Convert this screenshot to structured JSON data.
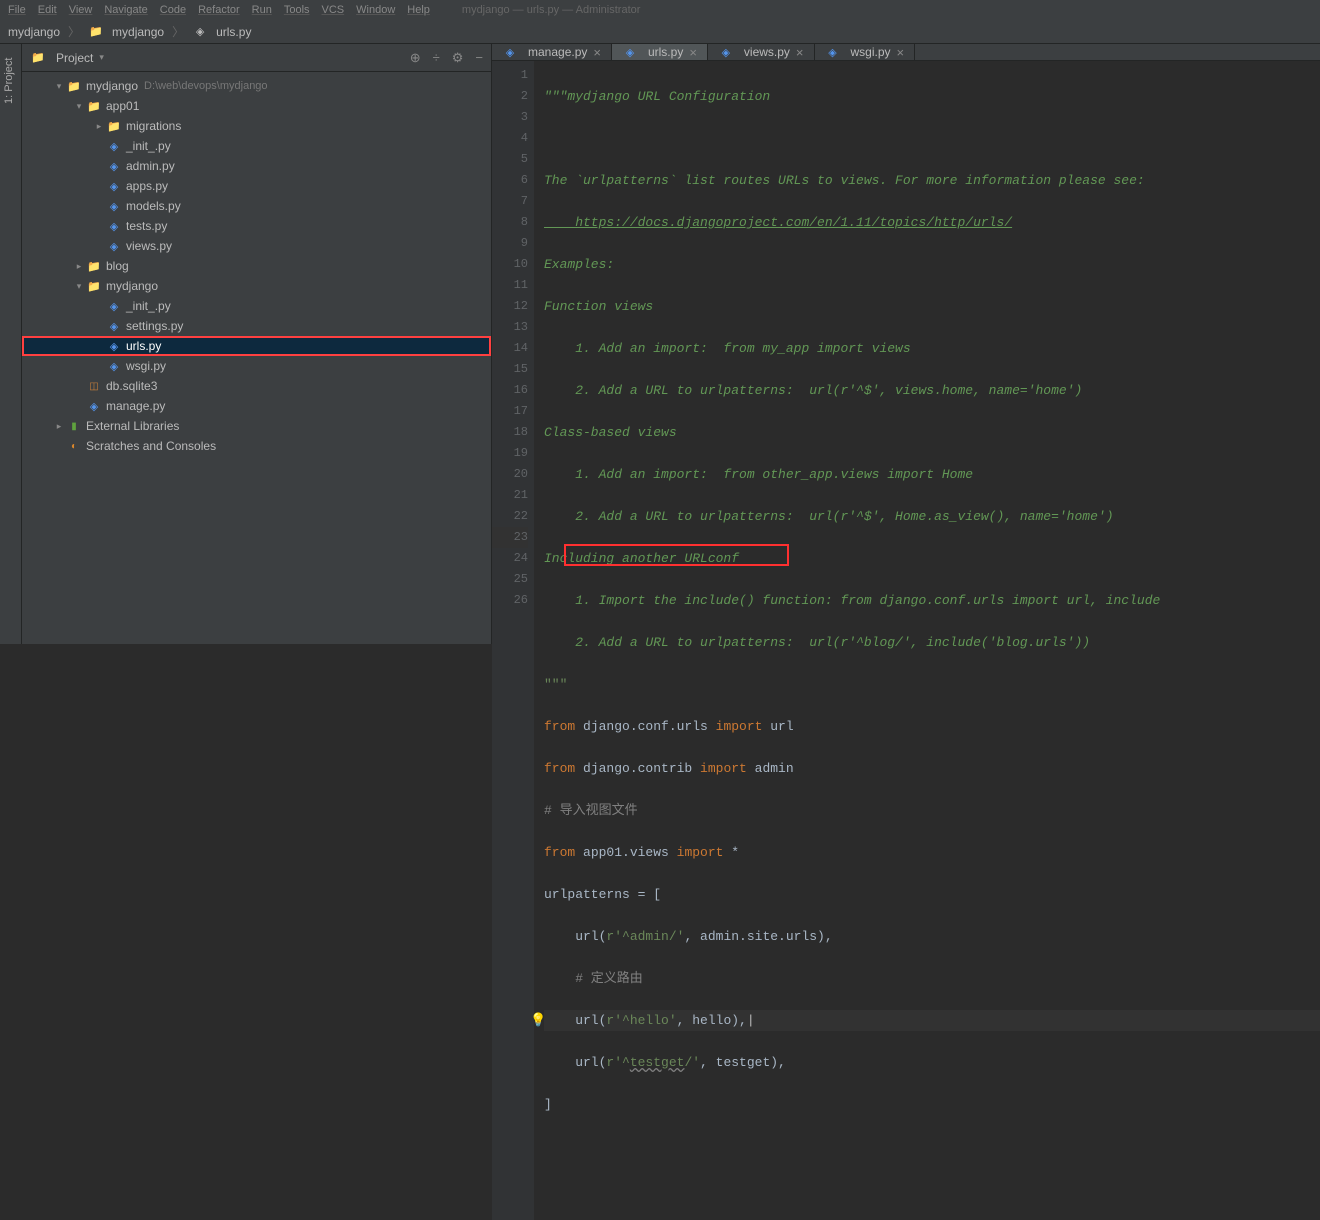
{
  "menubar": [
    "File",
    "Edit",
    "View",
    "Navigate",
    "Code",
    "Refactor",
    "Run",
    "Tools",
    "VCS",
    "Window",
    "Help"
  ],
  "titlebar_extra": "mydjango — urls.py — Administrator",
  "breadcrumb": {
    "root": "mydjango",
    "mid": "mydjango",
    "file": "urls.py"
  },
  "sidebar_tab": "1: Project",
  "project_header": {
    "title": "Project",
    "icons": [
      "⊕",
      "÷",
      "⚙",
      "−"
    ]
  },
  "tree": [
    {
      "indent": 0,
      "arrow": "▾",
      "icon": "folder",
      "label": "mydjango",
      "path": "D:\\web\\devops\\mydjango"
    },
    {
      "indent": 1,
      "arrow": "▾",
      "icon": "folder",
      "label": "app01"
    },
    {
      "indent": 2,
      "arrow": "▸",
      "icon": "folder",
      "label": "migrations"
    },
    {
      "indent": 2,
      "arrow": "",
      "icon": "py",
      "label": "_init_.py"
    },
    {
      "indent": 2,
      "arrow": "",
      "icon": "py",
      "label": "admin.py"
    },
    {
      "indent": 2,
      "arrow": "",
      "icon": "py",
      "label": "apps.py"
    },
    {
      "indent": 2,
      "arrow": "",
      "icon": "py",
      "label": "models.py"
    },
    {
      "indent": 2,
      "arrow": "",
      "icon": "py",
      "label": "tests.py"
    },
    {
      "indent": 2,
      "arrow": "",
      "icon": "py",
      "label": "views.py"
    },
    {
      "indent": 1,
      "arrow": "▸",
      "icon": "folder",
      "label": "blog"
    },
    {
      "indent": 1,
      "arrow": "▾",
      "icon": "folder",
      "label": "mydjango"
    },
    {
      "indent": 2,
      "arrow": "",
      "icon": "py",
      "label": "_init_.py"
    },
    {
      "indent": 2,
      "arrow": "",
      "icon": "py",
      "label": "settings.py"
    },
    {
      "indent": 2,
      "arrow": "",
      "icon": "py",
      "label": "urls.py",
      "selected": true,
      "highlighted": true
    },
    {
      "indent": 2,
      "arrow": "",
      "icon": "py",
      "label": "wsgi.py"
    },
    {
      "indent": 1,
      "arrow": "",
      "icon": "db",
      "label": "db.sqlite3"
    },
    {
      "indent": 1,
      "arrow": "",
      "icon": "py",
      "label": "manage.py"
    },
    {
      "indent": 0,
      "arrow": "▸",
      "icon": "lib",
      "label": "External Libraries"
    },
    {
      "indent": 0,
      "arrow": "",
      "icon": "scratch",
      "label": "Scratches and Consoles"
    }
  ],
  "editor_tabs": [
    {
      "label": "manage.py",
      "active": false
    },
    {
      "label": "urls.py",
      "active": true
    },
    {
      "label": "views.py",
      "active": false
    },
    {
      "label": "wsgi.py",
      "active": false
    }
  ],
  "line_count": 26,
  "current_line": 23,
  "code": {
    "l1": "\"\"\"mydjango URL Configuration",
    "l2": "",
    "l3": "The `urlpatterns` list routes URLs to views. For more information please see:",
    "l4": "    https://docs.djangoproject.com/en/1.11/topics/http/urls/",
    "l5": "Examples:",
    "l6": "Function views",
    "l7": "    1. Add an import:  from my_app import views",
    "l8": "    2. Add a URL to urlpatterns:  url(r'^$', views.home, name='home')",
    "l9": "Class-based views",
    "l10": "    1. Add an import:  from other_app.views import Home",
    "l11": "    2. Add a URL to urlpatterns:  url(r'^$', Home.as_view(), name='home')",
    "l12": "Including another URLconf",
    "l13": "    1. Import the include() function: from django.conf.urls import url, include",
    "l14": "    2. Add a URL to urlpatterns:  url(r'^blog/', include('blog.urls'))",
    "l15": "\"\"\"",
    "l16_from": "from ",
    "l16_mod": "django.conf.urls ",
    "l16_imp": "import ",
    "l16_id": "url",
    "l17_from": "from ",
    "l17_mod": "django.contrib ",
    "l17_imp": "import ",
    "l17_id": "admin",
    "l18": "# 导入视图文件",
    "l19_from": "from ",
    "l19_mod": "app01.views ",
    "l19_imp": "import ",
    "l19_star": "*",
    "l20_a": "urlpatterns = [",
    "l21_a": "    url(",
    "l21_b": "r'^admin/'",
    "l21_c": ", admin.site.urls),",
    "l22": "    # 定义路由",
    "l23_a": "    url(",
    "l23_b": "r'^hello'",
    "l23_c": ", hello),",
    "l24_a": "    url(",
    "l24_b": "r'^",
    "l24_c": "testget",
    "l24_d": "/'",
    "l24_e": ", testget),",
    "l25": "]",
    "l26": ""
  }
}
